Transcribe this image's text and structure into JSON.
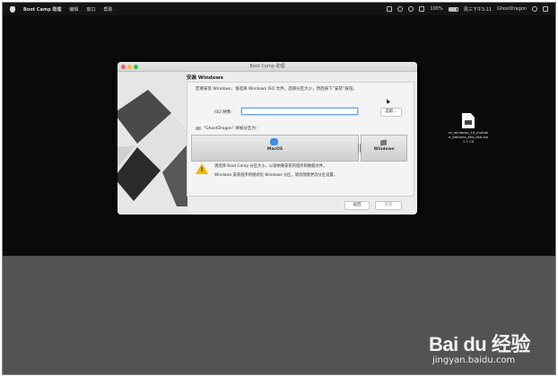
{
  "menubar": {
    "app_name": "Boot Camp 助理",
    "menus": [
      "编辑",
      "窗口",
      "帮助"
    ],
    "battery": "100%",
    "datetime": "周三下午3:11",
    "user": "GhostDragon"
  },
  "dialog": {
    "title": "Boot Camp 助理",
    "heading": "安装 Windows",
    "intro": "若要安装 Windows，请选择 Windows ISO 文件，选择分区大小，然后按下“安装”按钮。",
    "iso_label": "ISO 映像：",
    "iso_value": "",
    "choose_button": "选取…",
    "partition_label": "“GhostDragon” 将被分区为：",
    "mac_partition": {
      "name": "MacOS",
      "size": ""
    },
    "win_partition": {
      "name": "Windows",
      "size": ""
    },
    "warning_line1": "请选择 Boot Camp 分区大小，以容纳要安装的程序和数据文件。",
    "warning_line2": "Windows 安装程序将格式化 Windows 分区，请勿随意更改分区设置。",
    "back_button": "返回",
    "install_button": "安装"
  },
  "desktop_file": {
    "name": "cn_windows_10_multiple_editions_x64_dvd.iso",
    "size": "3.9 GB"
  },
  "watermark": {
    "brand": "Bai du 经验",
    "url": "jingyan.baidu.com"
  },
  "colors": {
    "desktop": "#0b0b0b",
    "lower_band": "#535353",
    "dialog": "#ececec",
    "accent_focus": "#6fa8e6",
    "warning": "#f1b900"
  }
}
